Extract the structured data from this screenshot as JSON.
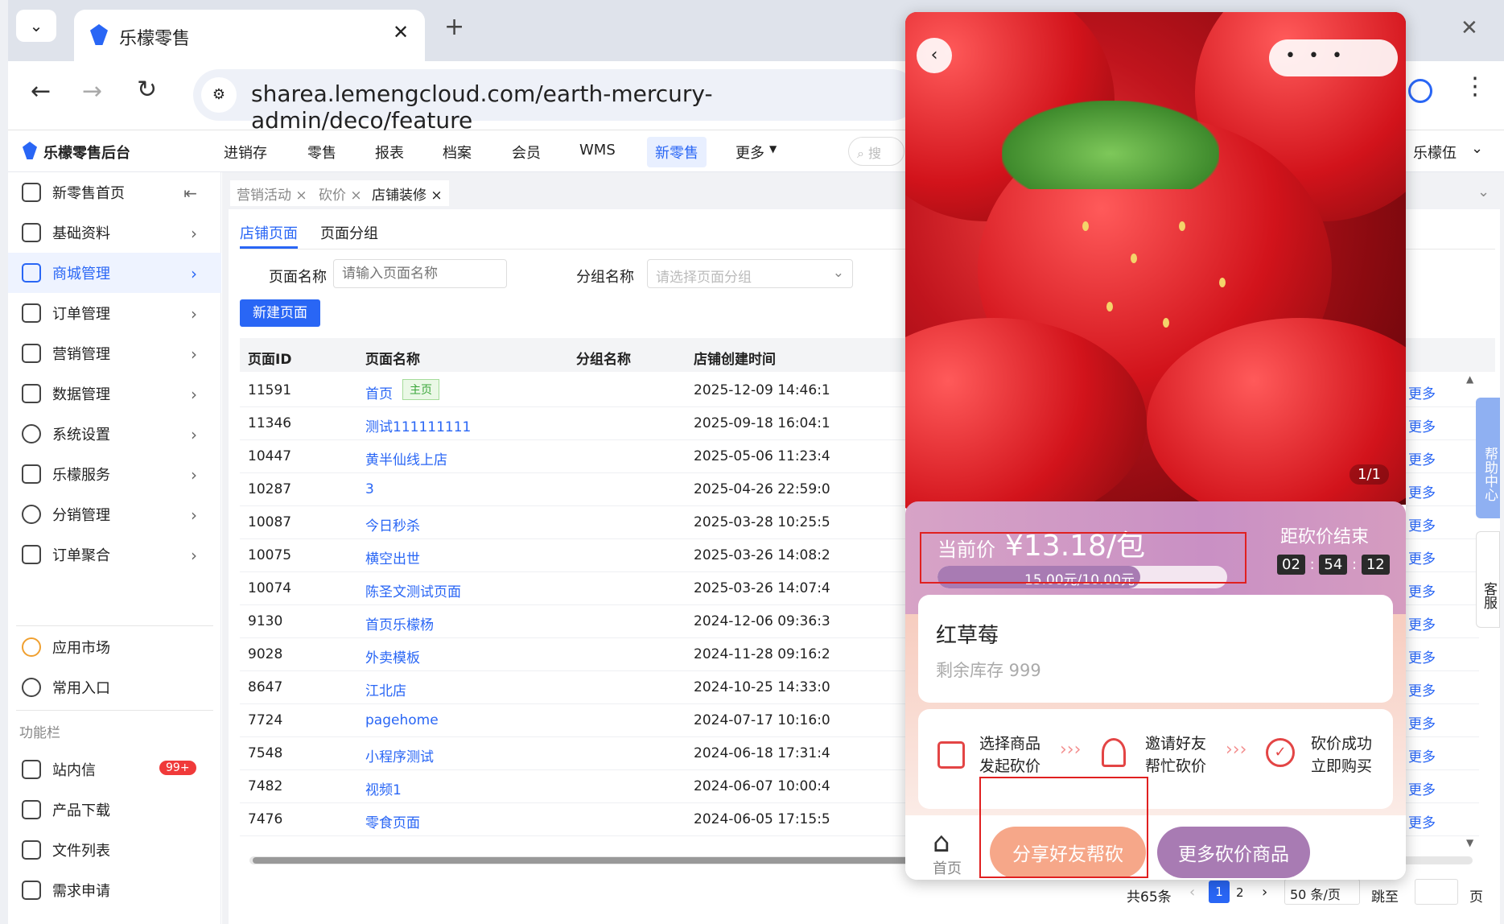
{
  "browser": {
    "tab_title": "乐檬零售",
    "url": "sharea.lemengcloud.com/earth-mercury-admin/deco/feature"
  },
  "app": {
    "logo_text": "乐檬零售后台",
    "nav": [
      "进销存",
      "零售",
      "报表",
      "档案",
      "会员",
      "WMS",
      "新零售",
      "更多"
    ],
    "search_placeholder": "搜",
    "user": "乐檬伍"
  },
  "sidebar": {
    "items": [
      {
        "label": "新零售首页",
        "icon": "home-icon"
      },
      {
        "label": "基础资料",
        "icon": "grid-icon"
      },
      {
        "label": "商城管理",
        "icon": "shop-icon"
      },
      {
        "label": "订单管理",
        "icon": "order-icon"
      },
      {
        "label": "营销管理",
        "icon": "marketing-icon"
      },
      {
        "label": "数据管理",
        "icon": "chart-icon"
      },
      {
        "label": "系统设置",
        "icon": "settings-icon"
      },
      {
        "label": "乐檬服务",
        "icon": "service-icon"
      },
      {
        "label": "分销管理",
        "icon": "distribution-icon"
      },
      {
        "label": "订单聚合",
        "icon": "aggregate-icon"
      }
    ],
    "app_market": "应用市场",
    "common_entry": "常用入口",
    "section_label": "功能栏",
    "bottom_items": [
      {
        "label": "站内信",
        "badge": "99+"
      },
      {
        "label": "产品下载"
      },
      {
        "label": "文件列表"
      },
      {
        "label": "需求申请"
      }
    ]
  },
  "breadcrumb_tabs": [
    "营销活动",
    "砍价",
    "店铺装修"
  ],
  "page_tabs": [
    "店铺页面",
    "页面分组"
  ],
  "filters": {
    "name_label": "页面名称",
    "name_placeholder": "请输入页面名称",
    "group_label": "分组名称",
    "group_placeholder": "请选择页面分组"
  },
  "new_page_button": "新建页面",
  "table": {
    "headers": [
      "页面ID",
      "页面名称",
      "分组名称",
      "店铺创建时间"
    ],
    "home_tag": "主页",
    "more_label": "更多",
    "rows": [
      {
        "id": "11591",
        "name": "首页",
        "time": "2025-12-09 14:46:1"
      },
      {
        "id": "11346",
        "name": "测试111111111",
        "time": "2025-09-18 16:04:1"
      },
      {
        "id": "10447",
        "name": "黄半仙线上店",
        "time": "2025-05-06 11:23:4"
      },
      {
        "id": "10287",
        "name": "3",
        "time": "2025-04-26 22:59:0"
      },
      {
        "id": "10087",
        "name": "今日秒杀",
        "time": "2025-03-28 10:25:5"
      },
      {
        "id": "10075",
        "name": "横空出世",
        "time": "2025-03-26 14:08:2"
      },
      {
        "id": "10074",
        "name": "陈圣文测试页面",
        "time": "2025-03-26 14:07:4"
      },
      {
        "id": "9130",
        "name": "首页乐檬杨",
        "time": "2024-12-06 09:36:3"
      },
      {
        "id": "9028",
        "name": "外卖模板",
        "time": "2024-11-28 09:16:2"
      },
      {
        "id": "8647",
        "name": "江北店",
        "time": "2024-10-25 14:33:0"
      },
      {
        "id": "7724",
        "name": "pagehome",
        "time": "2024-07-17 10:16:0"
      },
      {
        "id": "7548",
        "name": "小程序测试",
        "time": "2024-06-18 17:31:4"
      },
      {
        "id": "7482",
        "name": "视频1",
        "time": "2024-06-07 10:00:4"
      },
      {
        "id": "7476",
        "name": "零食页面",
        "time": "2024-06-05 17:15:5"
      }
    ]
  },
  "pagination": {
    "total": "共65条",
    "pages": [
      "1",
      "2"
    ],
    "page_size": "50 条/页",
    "jump_label": "跳至",
    "page_suffix": "页"
  },
  "side_help": {
    "help": "帮助中心",
    "service": "客服"
  },
  "phone": {
    "image_counter": "1/1",
    "price_label": "当前价",
    "price": "¥13.18/包",
    "progress_text": "15.00元/10.00元",
    "progress_fraction": 0.7,
    "countdown_label": "距砍价结束",
    "countdown": [
      "02",
      "54",
      "12"
    ],
    "product_name": "红草莓",
    "stock": "剩余库存 999",
    "steps": [
      {
        "line1": "选择商品",
        "line2": "发起砍价"
      },
      {
        "line1": "邀请好友",
        "line2": "帮忙砍价"
      },
      {
        "line1": "砍价成功",
        "line2": "立即购买"
      }
    ],
    "home_label": "首页",
    "share_button": "分享好友帮砍",
    "more_button": "更多砍价商品",
    "colors": {
      "share": "#f6a789",
      "more": "#a87bb3",
      "accent": "#2966f5"
    }
  }
}
